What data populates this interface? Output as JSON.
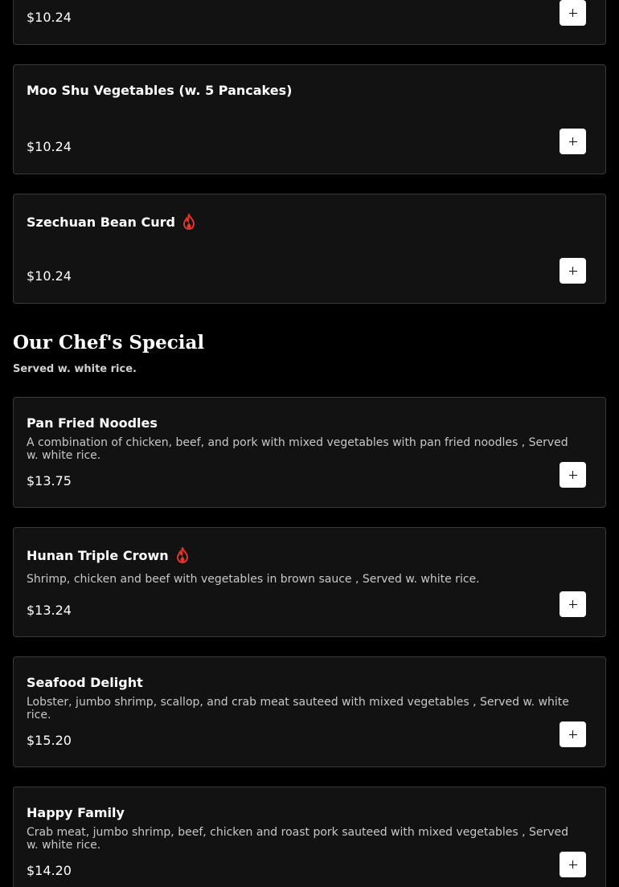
{
  "items_top": [
    {
      "name": "",
      "price": "$10.24",
      "spicy": false
    },
    {
      "name": "Moo Shu Vegetables (w. 5 Pancakes)",
      "price": "$10.24",
      "spicy": false
    },
    {
      "name": "Szechuan Bean Curd",
      "price": "$10.24",
      "spicy": true
    }
  ],
  "section": {
    "title": "Our Chef's Special",
    "subtitle": "Served w. white rice."
  },
  "items_special": [
    {
      "name": "Pan Fried Noodles",
      "description": "A combination of chicken, beef, and pork with mixed vegetables with pan fried noodles , Served w. white rice.",
      "price": "$13.75",
      "spicy": false
    },
    {
      "name": "Hunan Triple Crown",
      "description": "Shrimp, chicken and beef with vegetables in brown sauce , Served w. white rice.",
      "price": "$13.24",
      "spicy": true
    },
    {
      "name": "Seafood Delight",
      "description": "Lobster, jumbo shrimp, scallop, and crab meat sauteed with mixed vegetables , Served w. white rice.",
      "price": "$15.20",
      "spicy": false
    },
    {
      "name": "Happy Family",
      "description": "Crab meat, jumbo shrimp, beef, chicken and roast pork sauteed with mixed vegetables , Served w. white rice.",
      "price": "$14.20",
      "spicy": false
    }
  ],
  "colors": {
    "spicy": "#e0382b",
    "card_bg": "#121212",
    "card_border": "#3a3a3a"
  },
  "icons": {
    "spicy": "flame-icon",
    "add": "plus-icon"
  }
}
